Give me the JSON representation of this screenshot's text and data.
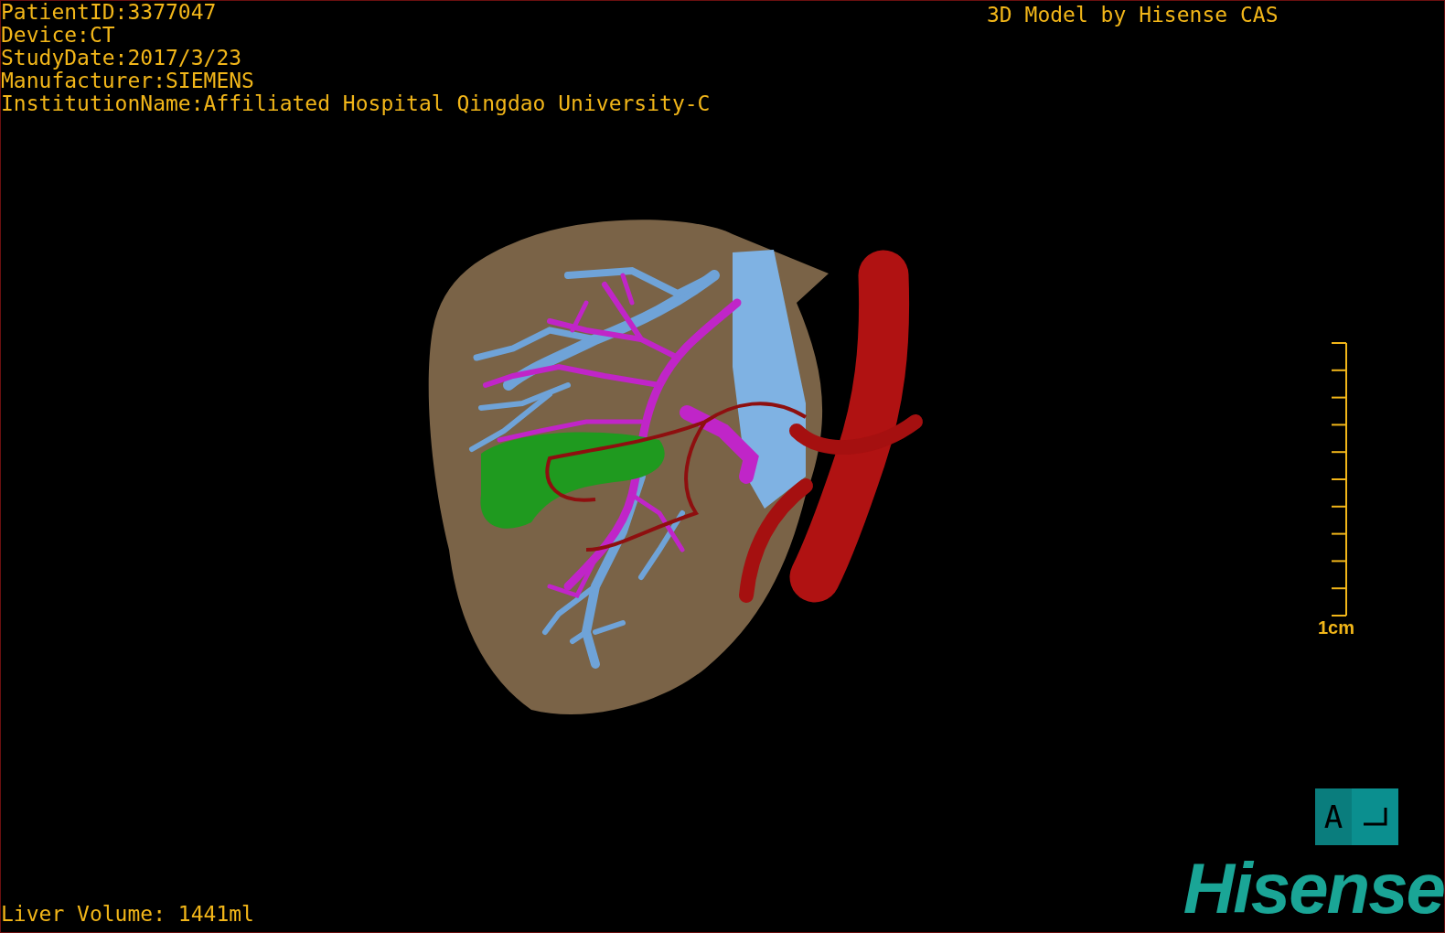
{
  "info_lines": [
    "PatientID:3377047",
    "Device:CT",
    "StudyDate:2017/3/23",
    "Manufacturer:SIEMENS",
    "InstitutionName:Affiliated Hospital Qingdao University-C"
  ],
  "title": "3D Model by Hisense CAS",
  "scale_bar": {
    "label": "1cm"
  },
  "orientation_marker": {
    "letter": "A"
  },
  "logo": "Hisense",
  "liver_volume": "Liver Volume: 1441ml"
}
